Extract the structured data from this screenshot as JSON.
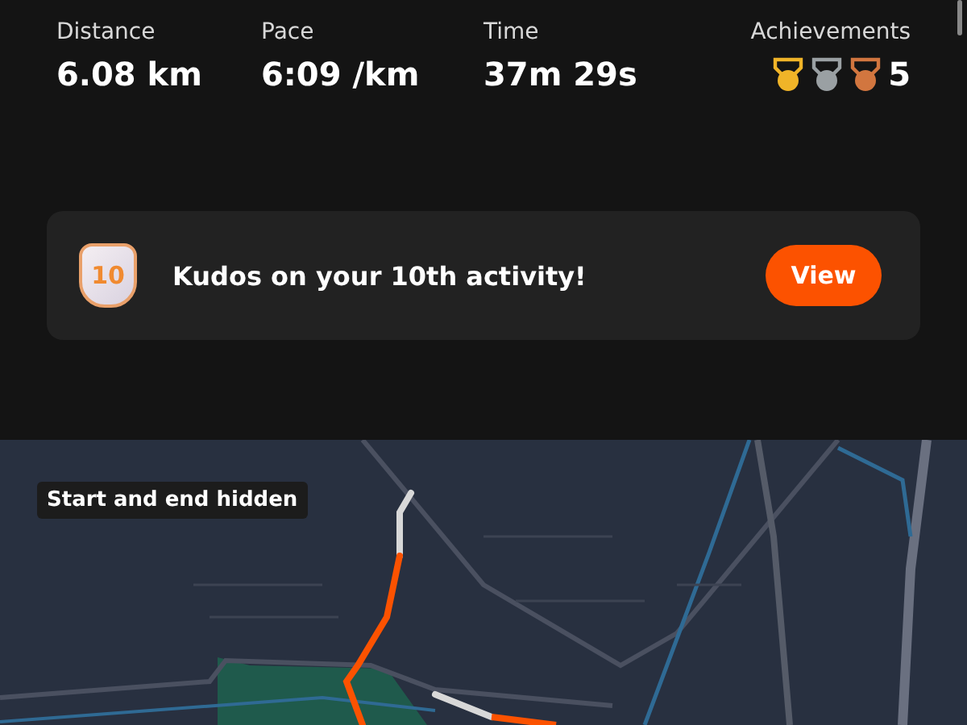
{
  "stats": [
    {
      "kind": "text",
      "label": "Distance",
      "value": "6.08 km"
    },
    {
      "kind": "text",
      "label": "Pace",
      "value": "6:09 /km"
    },
    {
      "kind": "text",
      "label": "Time",
      "value": "37m 29s"
    },
    {
      "kind": "medals",
      "label": "Achievements",
      "value": "5",
      "medals": [
        {
          "color": "#f0b428"
        },
        {
          "color": "#9aa0a3"
        },
        {
          "color": "#d2763f"
        }
      ]
    }
  ],
  "banner": {
    "badge": "10",
    "message": "Kudos on your 10th activity!",
    "button": "View"
  },
  "map": {
    "kind": "picture",
    "overlay": "Start and end hidden"
  }
}
